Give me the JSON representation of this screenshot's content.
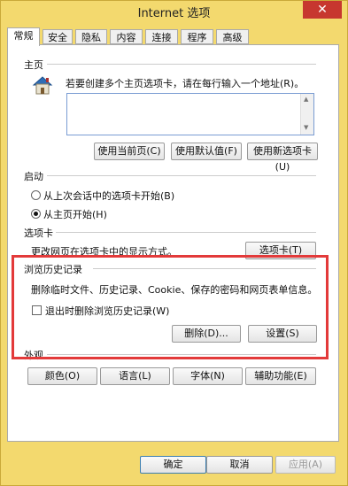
{
  "window": {
    "title": "Internet 选项",
    "close_symbol": "✕"
  },
  "tabs": [
    "常规",
    "安全",
    "隐私",
    "内容",
    "连接",
    "程序",
    "高级"
  ],
  "home": {
    "section": "主页",
    "hint": "若要创建多个主页选项卡，请在每行输入一个地址(R)。",
    "buttons": [
      "使用当前页(C)",
      "使用默认值(F)",
      "使用新选项卡(U)"
    ]
  },
  "startup": {
    "section": "启动",
    "option1": "从上次会话中的选项卡开始(B)",
    "option2": "从主页开始(H)"
  },
  "tabs_section": {
    "section": "选项卡",
    "desc": "更改网页在选项卡中的显示方式。",
    "button": "选项卡(T)"
  },
  "history": {
    "section": "浏览历史记录",
    "desc": "删除临时文件、历史记录、Cookie、保存的密码和网页表单信息。",
    "checkbox": "退出时删除浏览历史记录(W)",
    "delete": "删除(D)...",
    "settings": "设置(S)"
  },
  "appearance": {
    "section": "外观",
    "buttons": [
      "颜色(O)",
      "语言(L)",
      "字体(N)",
      "辅助功能(E)"
    ]
  },
  "footer": {
    "ok": "确定",
    "cancel": "取消",
    "apply": "应用(A)"
  },
  "colors": {
    "window_frame": "#f3d96e",
    "highlight_box": "#e33a3a",
    "close_button": "#c7372f"
  },
  "icons": {
    "home": "house-icon"
  }
}
